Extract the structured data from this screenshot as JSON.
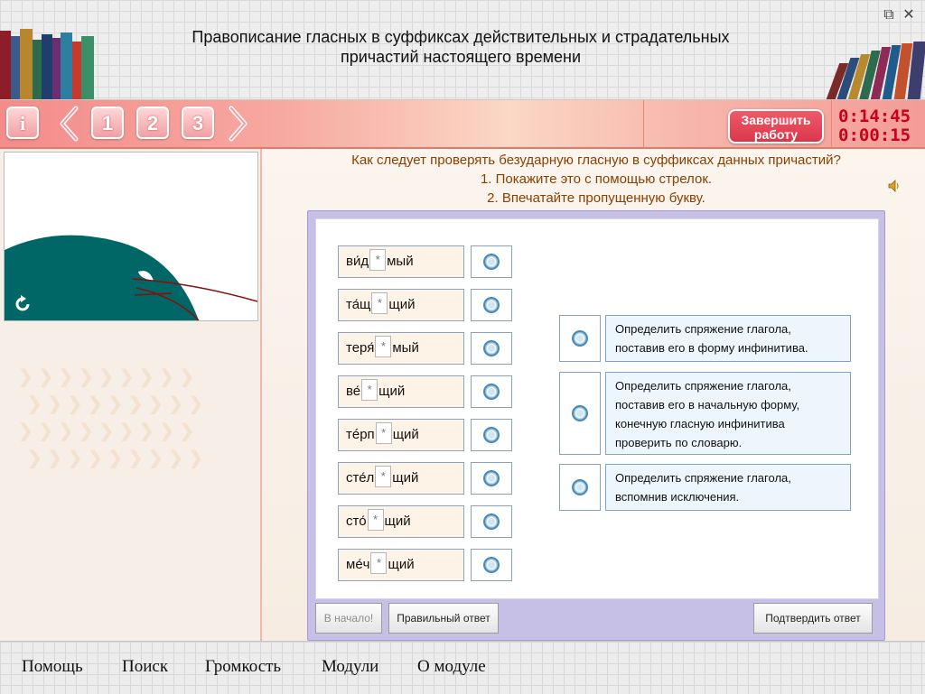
{
  "header": {
    "title_line1": "Правописание гласных в суффиксах действительных и страдательных",
    "title_line2": "причастий настоящего времени"
  },
  "window": {
    "restore_glyph": "⧉",
    "close_glyph": "✕"
  },
  "toolbar": {
    "info_label": "i",
    "pages": [
      "1",
      "2",
      "3"
    ],
    "finish_line1": "Завершить",
    "finish_line2": "работу",
    "timer_total": "0:14:45",
    "timer_task": "0:00:15"
  },
  "question": {
    "line1": "Как следует проверять безударную гласную в суффиксах данных причастий?",
    "line2": "1. Покажите это с помощью стрелок.",
    "line3": "2. Впечатайте пропущенную букву."
  },
  "words": [
    {
      "before": "ви́д",
      "blank": "*",
      "after": "мый"
    },
    {
      "before": "та́щ",
      "blank": "*",
      "after": "щий"
    },
    {
      "before": "теря́",
      "blank": "*",
      "after": "мый"
    },
    {
      "before": "ве́",
      "blank": "*",
      "after": "щий"
    },
    {
      "before": "тéрп",
      "blank": "*",
      "after": "щий"
    },
    {
      "before": "сте́л",
      "blank": "*",
      "after": "щий"
    },
    {
      "before": "сто́",
      "blank": "*",
      "after": "щий"
    },
    {
      "before": "ме́ч",
      "blank": "*",
      "after": "щий"
    }
  ],
  "options": [
    {
      "lines": [
        "Определить спряжение глагола,",
        "поставив его в форму инфинитива."
      ]
    },
    {
      "lines": [
        "Определить спряжение глагола,",
        "поставив его в начальную форму,",
        "конечную гласную инфинитива",
        "проверить по словарю."
      ]
    },
    {
      "lines": [
        "Определить спряжение глагола,",
        "вспомнив исключения."
      ]
    }
  ],
  "buttons": {
    "start": "В начало!",
    "correct": "Правильный ответ",
    "confirm": "Подтвердить ответ"
  },
  "footer": {
    "menu": [
      "Помощь",
      "Поиск",
      "Громкость",
      "Модули",
      "О модуле"
    ]
  },
  "colors": {
    "accent_red": "#c8001a",
    "toolbar_pink": "#f49c97",
    "question_brown": "#8a3f00",
    "teal_shape": "#006766"
  },
  "icons": {
    "replay": "replay-icon",
    "speaker": "speaker-icon",
    "prev": "arrow-left-icon",
    "next": "arrow-right-icon"
  }
}
